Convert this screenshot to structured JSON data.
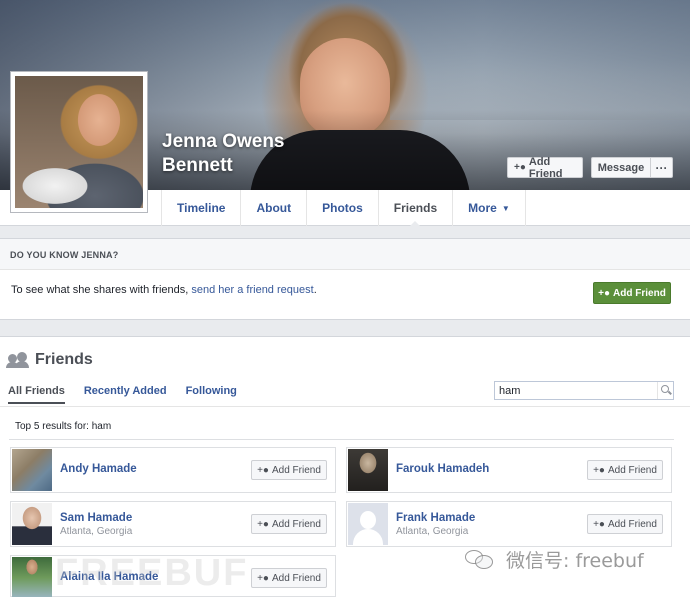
{
  "profile": {
    "name_line1": "Jenna Owens",
    "name_line2": "Bennett"
  },
  "cover_actions": {
    "add_friend": "Add Friend",
    "message": "Message",
    "more": "···"
  },
  "nav": {
    "tabs": [
      {
        "label": "Timeline"
      },
      {
        "label": "About"
      },
      {
        "label": "Photos"
      },
      {
        "label": "Friends",
        "active": true
      },
      {
        "label": "More",
        "caret": "▼"
      }
    ]
  },
  "know_box": {
    "heading": "DO YOU KNOW JENNA?",
    "text_prefix": "To see what she shares with friends, ",
    "link": "send her a friend request",
    "text_suffix": ".",
    "button": "Add Friend",
    "button_color": "#5b8f3a"
  },
  "friends": {
    "title": "Friends",
    "subtabs": [
      "All Friends",
      "Recently Added",
      "Following"
    ],
    "search_value": "ham",
    "results_label": "Top 5 results for: ham",
    "cards": [
      {
        "name": "Andy Hamade",
        "location": "",
        "button": "Add Friend"
      },
      {
        "name": "Farouk Hamadeh",
        "location": "",
        "button": "Add Friend"
      },
      {
        "name": "Sam Hamade",
        "location": "Atlanta, Georgia",
        "button": "Add Friend"
      },
      {
        "name": "Frank Hamade",
        "location": "Atlanta, Georgia",
        "button": "Add Friend"
      },
      {
        "name": "Alaina Ila Hamade",
        "location": "",
        "button": "Add Friend"
      }
    ]
  },
  "watermark": {
    "text": "微信号: freebuf",
    "faint": "FREEBUF"
  },
  "colors": {
    "link": "#365899",
    "page_bg": "#e9ebee",
    "green_button": "#5b8f3a"
  },
  "icons": [
    "add-friend-icon",
    "friends-icon",
    "search-icon",
    "caret-down-icon",
    "wechat-icon"
  ]
}
